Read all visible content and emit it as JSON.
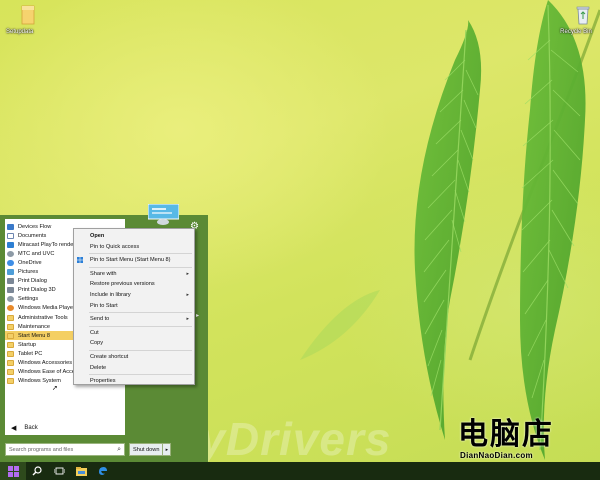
{
  "desktop": {
    "icons": [
      {
        "label": "Setupdata",
        "icon": "folder-icon"
      },
      {
        "label": "Recycle Bin",
        "icon": "recycle-bin-icon"
      }
    ]
  },
  "watermarks": {
    "mydrivers": "MyDrivers",
    "logo_cn": "电脑店",
    "logo_en": "DianNaoDian.com"
  },
  "start_menu": {
    "items": [
      {
        "label": "Devices Flow",
        "icon": "devices-flow-icon"
      },
      {
        "label": "Documents",
        "icon": "documents-icon"
      },
      {
        "label": "Miracast PlayTo renderer",
        "icon": "miracast-icon"
      },
      {
        "label": "MTC and UVC",
        "icon": "gear-icon"
      },
      {
        "label": "OneDrive",
        "icon": "onedrive-icon"
      },
      {
        "label": "Pictures",
        "icon": "pictures-icon"
      },
      {
        "label": "Print Dialog",
        "icon": "printer-icon"
      },
      {
        "label": "Print Dialog 3D",
        "icon": "printer-icon"
      },
      {
        "label": "Settings",
        "icon": "gear-icon"
      },
      {
        "label": "Windows Media Player",
        "icon": "media-player-icon"
      },
      {
        "label": "Administrative Tools",
        "icon": "folder-icon"
      },
      {
        "label": "Maintenance",
        "icon": "folder-icon"
      },
      {
        "label": "Start Menu 8",
        "icon": "folder-icon",
        "selected": true
      },
      {
        "label": "Startup",
        "icon": "folder-icon"
      },
      {
        "label": "Tablet PC",
        "icon": "folder-icon"
      },
      {
        "label": "Windows Accessories",
        "icon": "folder-icon"
      },
      {
        "label": "Windows Ease of Access",
        "icon": "folder-icon"
      },
      {
        "label": "Windows System",
        "icon": "folder-icon"
      }
    ],
    "back_label": "Back",
    "search_placeholder": "Search programs and files",
    "shutdown_label": "Shut down",
    "accent_color": "#5b8a35",
    "selected_color": "#f4cf63"
  },
  "context_menu": {
    "items": [
      {
        "label": "Open",
        "bold": true
      },
      {
        "label": "Pin to Quick access"
      },
      {
        "separator": true
      },
      {
        "label": "Pin to Start Menu (Start Menu 8)",
        "icon": "windows-logo-icon"
      },
      {
        "separator": true
      },
      {
        "label": "Share with",
        "submenu": true
      },
      {
        "label": "Restore previous versions"
      },
      {
        "label": "Include in library",
        "submenu": true
      },
      {
        "label": "Pin to Start"
      },
      {
        "separator": true
      },
      {
        "label": "Send to",
        "submenu": true
      },
      {
        "separator": true
      },
      {
        "label": "Cut"
      },
      {
        "label": "Copy"
      },
      {
        "separator": true
      },
      {
        "label": "Create shortcut"
      },
      {
        "label": "Delete"
      },
      {
        "separator": true
      },
      {
        "label": "Properties"
      }
    ]
  },
  "taskbar": {
    "buttons": [
      {
        "name": "start-button",
        "icon": "windows-logo-icon"
      },
      {
        "name": "search-button",
        "icon": "search-icon"
      },
      {
        "name": "task-view-button",
        "icon": "task-view-icon"
      },
      {
        "name": "file-explorer-button",
        "icon": "file-explorer-icon"
      },
      {
        "name": "edge-button",
        "icon": "edge-icon"
      }
    ],
    "color": "#182b10"
  }
}
